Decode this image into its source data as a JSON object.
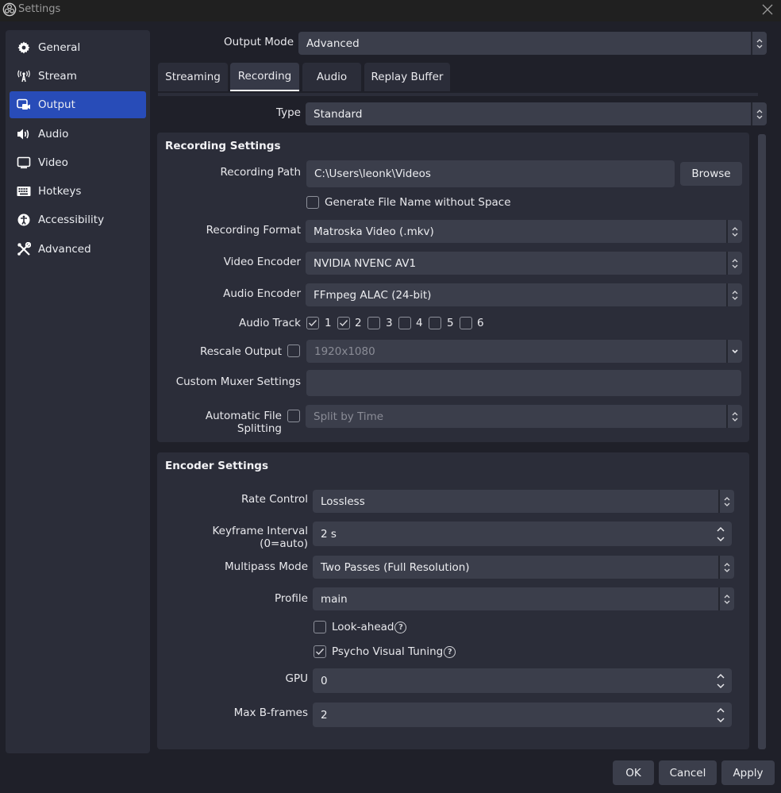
{
  "window": {
    "title": "Settings"
  },
  "sidebar": {
    "items": [
      {
        "label": "General",
        "icon": "gear-icon"
      },
      {
        "label": "Stream",
        "icon": "antenna-icon"
      },
      {
        "label": "Output",
        "icon": "output-icon",
        "active": true
      },
      {
        "label": "Audio",
        "icon": "speaker-icon"
      },
      {
        "label": "Video",
        "icon": "monitor-icon"
      },
      {
        "label": "Hotkeys",
        "icon": "keyboard-icon"
      },
      {
        "label": "Accessibility",
        "icon": "accessibility-icon"
      },
      {
        "label": "Advanced",
        "icon": "tools-icon"
      }
    ]
  },
  "output_mode": {
    "label": "Output Mode",
    "value": "Advanced"
  },
  "tabs": [
    {
      "label": "Streaming"
    },
    {
      "label": "Recording",
      "active": true
    },
    {
      "label": "Audio"
    },
    {
      "label": "Replay Buffer"
    }
  ],
  "type": {
    "label": "Type",
    "value": "Standard"
  },
  "recording_settings": {
    "title": "Recording Settings",
    "recording_path": {
      "label": "Recording Path",
      "value": "C:\\Users\\leonk\\Videos",
      "browse_label": "Browse"
    },
    "no_space": {
      "label": "Generate File Name without Space",
      "checked": false
    },
    "recording_format": {
      "label": "Recording Format",
      "value": "Matroska Video (.mkv)"
    },
    "video_encoder": {
      "label": "Video Encoder",
      "value": "NVIDIA NVENC AV1"
    },
    "audio_encoder": {
      "label": "Audio Encoder",
      "value": "FFmpeg ALAC (24-bit)"
    },
    "audio_track": {
      "label": "Audio Track",
      "tracks": [
        {
          "label": "1",
          "checked": true
        },
        {
          "label": "2",
          "checked": true
        },
        {
          "label": "3",
          "checked": false
        },
        {
          "label": "4",
          "checked": false
        },
        {
          "label": "5",
          "checked": false
        },
        {
          "label": "6",
          "checked": false
        }
      ]
    },
    "rescale_output": {
      "label": "Rescale Output",
      "checked": false,
      "value": "1920x1080"
    },
    "custom_muxer": {
      "label": "Custom Muxer Settings",
      "value": ""
    },
    "file_splitting": {
      "label": "Automatic File Splitting",
      "checked": false,
      "value": "Split by Time"
    }
  },
  "encoder_settings": {
    "title": "Encoder Settings",
    "rate_control": {
      "label": "Rate Control",
      "value": "Lossless"
    },
    "keyframe_interval": {
      "label": "Keyframe Interval (0=auto)",
      "value": "2 s"
    },
    "multipass_mode": {
      "label": "Multipass Mode",
      "value": "Two Passes (Full Resolution)"
    },
    "profile": {
      "label": "Profile",
      "value": "main"
    },
    "look_ahead": {
      "label": "Look-ahead",
      "checked": false
    },
    "psycho_visual": {
      "label": "Psycho Visual Tuning",
      "checked": true
    },
    "gpu": {
      "label": "GPU",
      "value": "0"
    },
    "max_bframes": {
      "label": "Max B-frames",
      "value": "2"
    }
  },
  "footer": {
    "ok_label": "OK",
    "cancel_label": "Cancel",
    "apply_label": "Apply"
  },
  "colors": {
    "accent": "#284cb8",
    "background": "#1f2029",
    "panel": "#2b2d39",
    "field": "#3b3e4b"
  }
}
